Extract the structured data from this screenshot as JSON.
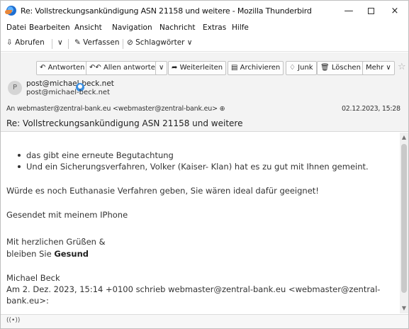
{
  "window": {
    "title": "Re: Vollstreckungsankündigung ASN 21158 und weitere - Mozilla Thunderbird",
    "minimize_glyph": "—",
    "close_glyph": "×"
  },
  "menu": {
    "items": [
      "Datei",
      "Bearbeiten",
      "Ansicht",
      "Navigation",
      "Nachricht",
      "Extras",
      "Hilfe"
    ]
  },
  "toolbar": {
    "get_mail": "Abrufen",
    "dropdown": "∨",
    "compose": "Verfassen",
    "tags": "Schlagwörter ∨"
  },
  "header_buttons": {
    "reply": "Antworten",
    "reply_all": "Allen antworten",
    "more_arrow": "∨",
    "forward": "Weiterleiten",
    "archive": "Archivieren",
    "junk": "Junk",
    "delete": "Löschen",
    "more": "Mehr ∨"
  },
  "message": {
    "avatar_letter": "P",
    "from_name": "post@michael-beck.net",
    "from_address": "post@michael-beck.net",
    "to_line": "An webmaster@zentral-bank.eu <webmaster@zentral-bank.eu> ⊕",
    "date": "02.12.2023, 15:28",
    "subject": "Re: Vollstreckungsankündigung ASN 21158 und weitere"
  },
  "body": {
    "bullets": [
      "das gibt eine erneute Begutachtung",
      "Und ein Sicherungsverfahren, Volker (Kaiser- Klan) hat es zu gut mit Ihnen gemeint."
    ],
    "line1": "Würde es noch Euthanasie Verfahren geben, Sie wären ideal dafür geeignet!",
    "line2": "Gesendet mit meinem IPhone",
    "line3": "Mit herzlichen Grüßen &",
    "line4_prefix": "bleiben Sie ",
    "line4_bold": "Gesund",
    "line5": "Michael Beck",
    "line6": "Am 2. Dez. 2023, 15:14 +0100 schrieb webmaster@zentral-bank.eu <webmaster@zentral-",
    "line7": "bank.eu>:"
  },
  "status": {
    "icon": "((•))"
  },
  "colors": {
    "header_bg": "#f3f3f3",
    "accent": "#1f6fd1"
  }
}
